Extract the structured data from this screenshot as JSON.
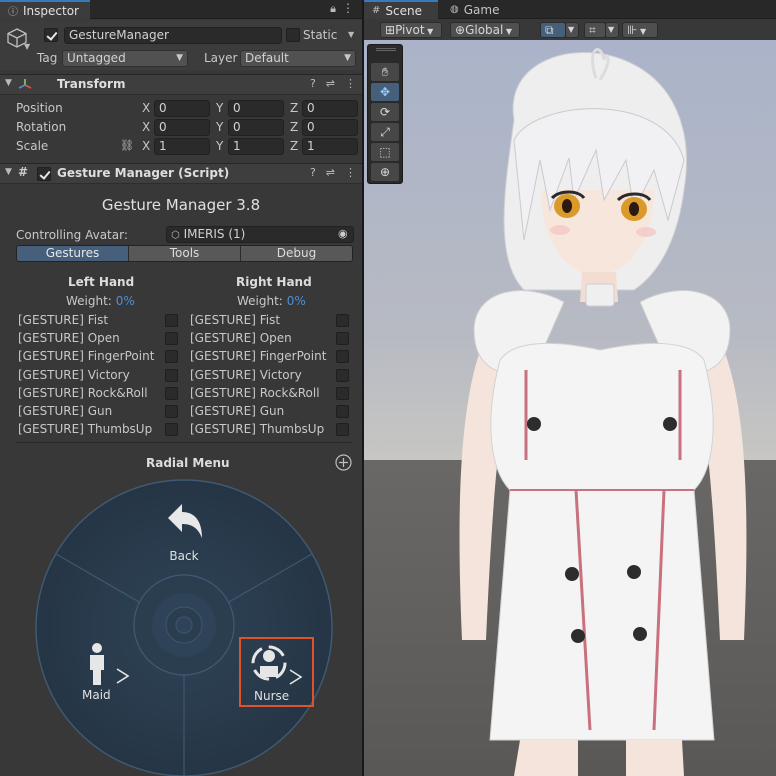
{
  "inspector": {
    "tab_label": "Inspector",
    "object_name": "GestureManager",
    "static_label": "Static",
    "tag_label": "Tag",
    "tag_value": "Untagged",
    "layer_label": "Layer",
    "layer_value": "Default",
    "transform": {
      "title": "Transform",
      "rows": [
        {
          "label": "Position",
          "x": "0",
          "y": "0",
          "z": "0"
        },
        {
          "label": "Rotation",
          "x": "0",
          "y": "0",
          "z": "0"
        },
        {
          "label": "Scale",
          "x": "1",
          "y": "1",
          "z": "1"
        }
      ],
      "axis_labels": {
        "x": "X",
        "y": "Y",
        "z": "Z"
      }
    },
    "script": {
      "title": "Gesture Manager (Script)",
      "heading": "Gesture Manager 3.8",
      "controlling_label": "Controlling Avatar:",
      "controlling_value": "IMERIS (1)",
      "tabs": [
        "Gestures",
        "Tools",
        "Debug"
      ],
      "selected_tab": "Gestures",
      "left_hand": "Left Hand",
      "right_hand": "Right Hand",
      "weight_label": "Weight:",
      "weight_left": "0%",
      "weight_right": "0%",
      "gestures": [
        "[GESTURE] Fist",
        "[GESTURE] Open",
        "[GESTURE] FingerPoint",
        "[GESTURE] Victory",
        "[GESTURE] Rock&Roll",
        "[GESTURE] Gun",
        "[GESTURE] ThumbsUp"
      ],
      "radial_title": "Radial Menu",
      "radial": {
        "back_label": "Back",
        "maid_label": "Maid",
        "nurse_label": "Nurse",
        "highlight_color": "#e0532a"
      }
    }
  },
  "scene": {
    "tabs": [
      "Scene",
      "Game"
    ],
    "pivot_label": "Pivot",
    "global_label": "Global"
  }
}
